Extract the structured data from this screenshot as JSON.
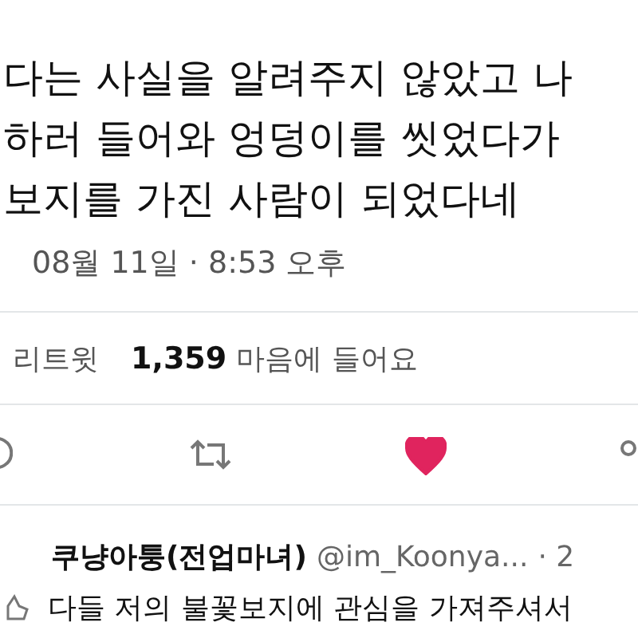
{
  "tweet": {
    "body_lines": [
      "다는 사실을 알려주지 않았고 나",
      "하러 들어와 엉덩이를 씻었다가",
      "보지를 가진 사람이 되었다네"
    ],
    "timestamp": "08월 11일 · 8:53 오후",
    "stats": {
      "retweets_label": "리트윗",
      "likes_count": "1,359",
      "likes_label": "마음에 들어요"
    },
    "actions": {
      "liked": true
    }
  },
  "reply": {
    "name": "쿠냥아퉁(전업마녀)",
    "handle": "@im_Koonya...",
    "time": "· 2",
    "text": "다들 저의 불꽃보지에 관심을 가져주셔서"
  }
}
